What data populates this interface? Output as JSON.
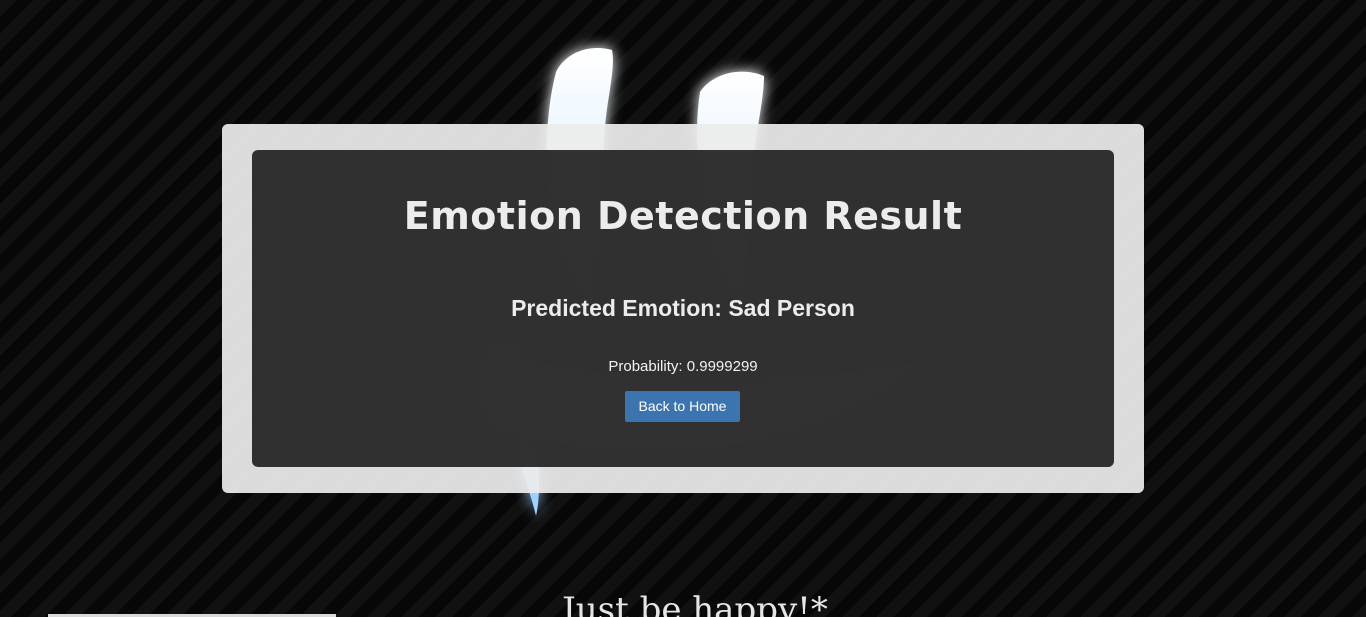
{
  "result": {
    "title": "Emotion Detection Result",
    "predicted_text": "Predicted Emotion: Sad Person",
    "probability_text": "Probability: 0.9999299",
    "back_button_label": "Back to Home"
  },
  "footer": {
    "tagline": "Just be happy!*"
  },
  "colors": {
    "page_background": "#0a0a0a",
    "outer_panel": "#ececec",
    "inner_panel": "#222222",
    "button": "#3c74b0",
    "glow": "#6ab8ff"
  },
  "background_art": {
    "icon": "sad-face-paint-icon"
  }
}
